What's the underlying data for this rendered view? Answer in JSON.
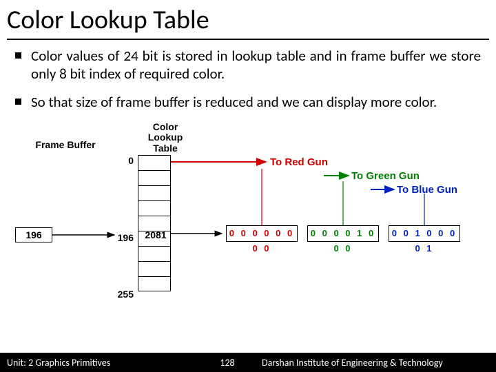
{
  "title": "Color Lookup Table",
  "bullets": [
    "Color values of 24 bit is stored in lookup table and in frame buffer we store only 8 bit index of required color.",
    "So that size of frame buffer is reduced and we can display more color."
  ],
  "diagram": {
    "frame_buffer_label": "Frame Buffer",
    "clut_label": "Color\nLookup\nTable",
    "fb_value": "196",
    "idx_top": "0",
    "idx_mid": "196",
    "idx_bot": "255",
    "clut_value": "2081",
    "red_bits": "0 0 0 0 0 0 0 0",
    "green_bits": "0 0 0 0 1 0 0 0",
    "blue_bits": "0 0 1 0 0 0 0 1",
    "gun_red": "To Red Gun",
    "gun_green": "To Green Gun",
    "gun_blue": "To Blue Gun"
  },
  "footer": {
    "unit": "Unit: 2 Graphics Primitives",
    "page": "128",
    "org": "Darshan Institute of Engineering & Technology"
  },
  "colors": {
    "red": "#d00000",
    "green": "#008000",
    "blue": "#0020c0"
  }
}
